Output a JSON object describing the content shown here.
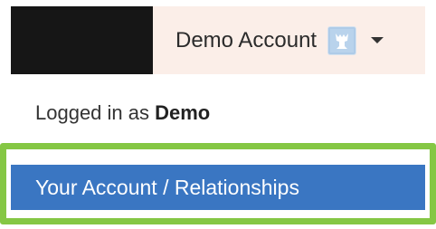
{
  "header": {
    "account_name": "Demo Account",
    "avatar_icon": "user-avatar-icon",
    "caret_icon": "caret-down-icon"
  },
  "dropdown": {
    "logged_in_prefix": "Logged in as",
    "logged_in_user": "Demo",
    "items": [
      {
        "label": "Your Account / Relationships",
        "highlighted": true
      }
    ]
  },
  "colors": {
    "menu_item_bg": "#3a76c2",
    "highlight_border": "#85c744",
    "toggle_bg": "#fbeee8"
  }
}
